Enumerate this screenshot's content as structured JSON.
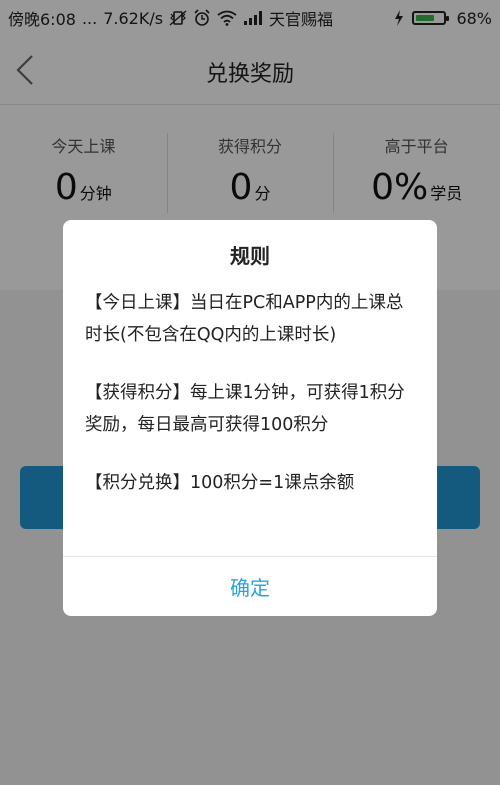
{
  "status_bar": {
    "time": "傍晚6:08",
    "dots": "...",
    "net_speed": "7.62K/s",
    "carrier": "天官赐福",
    "battery_percent": "68%",
    "battery_level": 0.68
  },
  "header": {
    "title": "兑换奖励"
  },
  "stats": [
    {
      "label": "今天上课",
      "value": "0",
      "unit": "分钟"
    },
    {
      "label": "获得积分",
      "value": "0",
      "unit": "分"
    },
    {
      "label": "高于平台",
      "value": "0%",
      "unit": "学员"
    }
  ],
  "dialog": {
    "title": "规则",
    "rules": [
      "【今日上课】当日在PC和APP内的上课总时长(不包含在QQ内的上课时长)",
      "【获得积分】每上课1分钟，可获得1积分奖励，每日最高可获得100积分",
      "【积分兑换】100积分=1课点余额"
    ],
    "confirm_label": "确定"
  },
  "colors": {
    "accent": "#29a3e0",
    "button_blue": "#2196d3",
    "battery_green": "#3bb54a"
  }
}
